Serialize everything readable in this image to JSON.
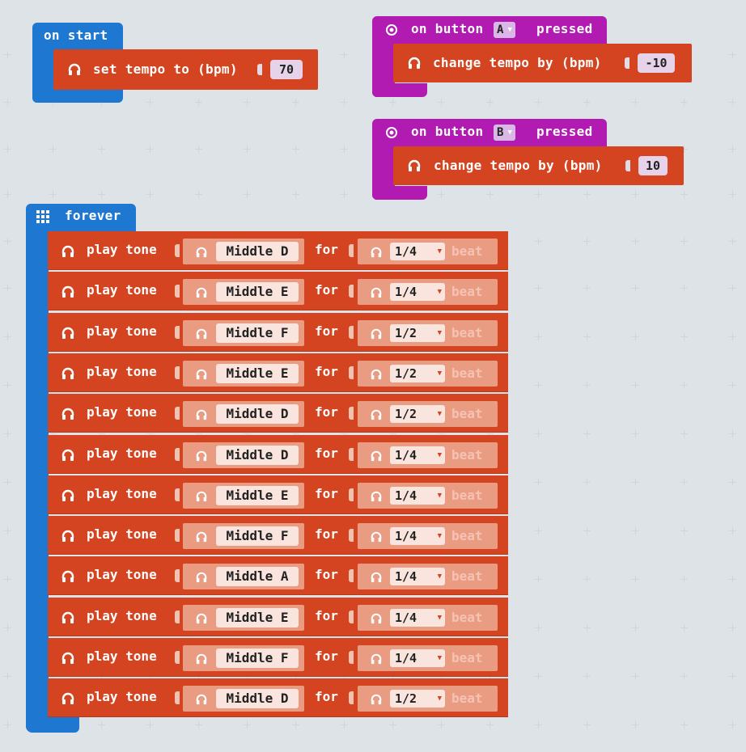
{
  "on_start": {
    "label": "on start",
    "block": {
      "text": "set tempo to (bpm)",
      "value": "70"
    }
  },
  "button_a": {
    "prefix": "on button",
    "button": "A",
    "suffix": "pressed",
    "block": {
      "text": "change tempo by (bpm)",
      "value": "-10"
    }
  },
  "button_b": {
    "prefix": "on button",
    "button": "B",
    "suffix": "pressed",
    "block": {
      "text": "change tempo by (bpm)",
      "value": "10"
    }
  },
  "forever": {
    "label": "forever",
    "play_label": "play tone",
    "for_label": "for",
    "beat_label": "beat",
    "rows": [
      {
        "note": "Middle D",
        "duration": "1/4"
      },
      {
        "note": "Middle E",
        "duration": "1/4"
      },
      {
        "note": "Middle F",
        "duration": "1/2"
      },
      {
        "note": "Middle E",
        "duration": "1/2"
      },
      {
        "note": "Middle D",
        "duration": "1/2"
      },
      {
        "note": "Middle D",
        "duration": "1/4"
      },
      {
        "note": "Middle E",
        "duration": "1/4"
      },
      {
        "note": "Middle F",
        "duration": "1/4"
      },
      {
        "note": "Middle A",
        "duration": "1/4"
      },
      {
        "note": "Middle E",
        "duration": "1/4"
      },
      {
        "note": "Middle F",
        "duration": "1/4"
      },
      {
        "note": "Middle D",
        "duration": "1/2"
      }
    ]
  },
  "colors": {
    "music": "#d54420",
    "basic": "#1e78d2",
    "input": "#b21bb2",
    "grid_bg": "#ecf0f2"
  },
  "icons": {
    "music": "headphones-icon",
    "input": "radio-button-icon",
    "basic": "grid-icon"
  }
}
